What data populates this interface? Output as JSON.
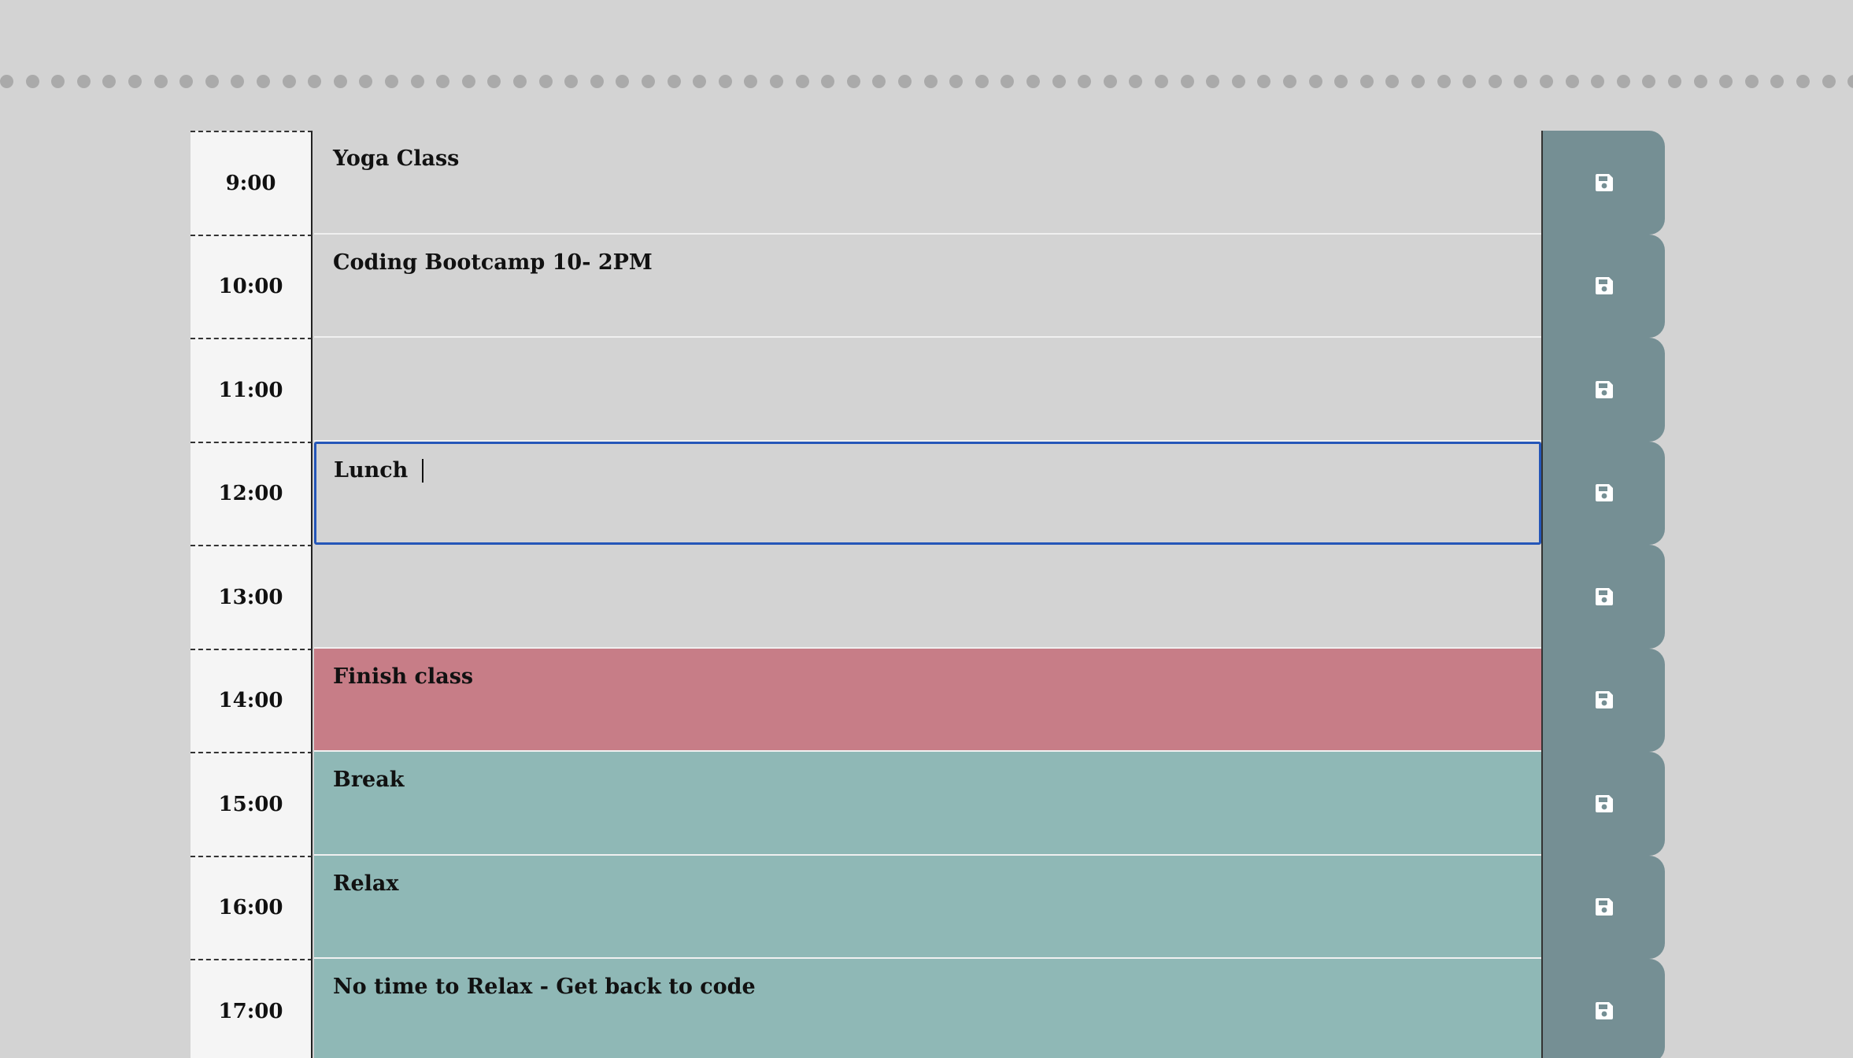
{
  "colors": {
    "background": "#d3d3d3",
    "past": "#d3d3d3",
    "present": "#c77d87",
    "future": "#8fb8b6",
    "save_button": "#758f94",
    "hour_cell": "#f5f5f5",
    "focus_border": "#2456b8"
  },
  "planner": {
    "rows": [
      {
        "hour": "9:00",
        "text": "Yoga Class",
        "state": "past"
      },
      {
        "hour": "10:00",
        "text": "Coding Bootcamp 10- 2PM",
        "state": "past"
      },
      {
        "hour": "11:00",
        "text": "",
        "state": "past"
      },
      {
        "hour": "12:00",
        "text": "Lunch ",
        "state": "past",
        "focused": true
      },
      {
        "hour": "13:00",
        "text": "",
        "state": "past"
      },
      {
        "hour": "14:00",
        "text": "Finish class",
        "state": "present"
      },
      {
        "hour": "15:00",
        "text": "Break",
        "state": "future"
      },
      {
        "hour": "16:00",
        "text": "Relax",
        "state": "future"
      },
      {
        "hour": "17:00",
        "text": "No time to Relax - Get back to code",
        "state": "future"
      }
    ],
    "save_icon": "floppy-disk-icon"
  }
}
